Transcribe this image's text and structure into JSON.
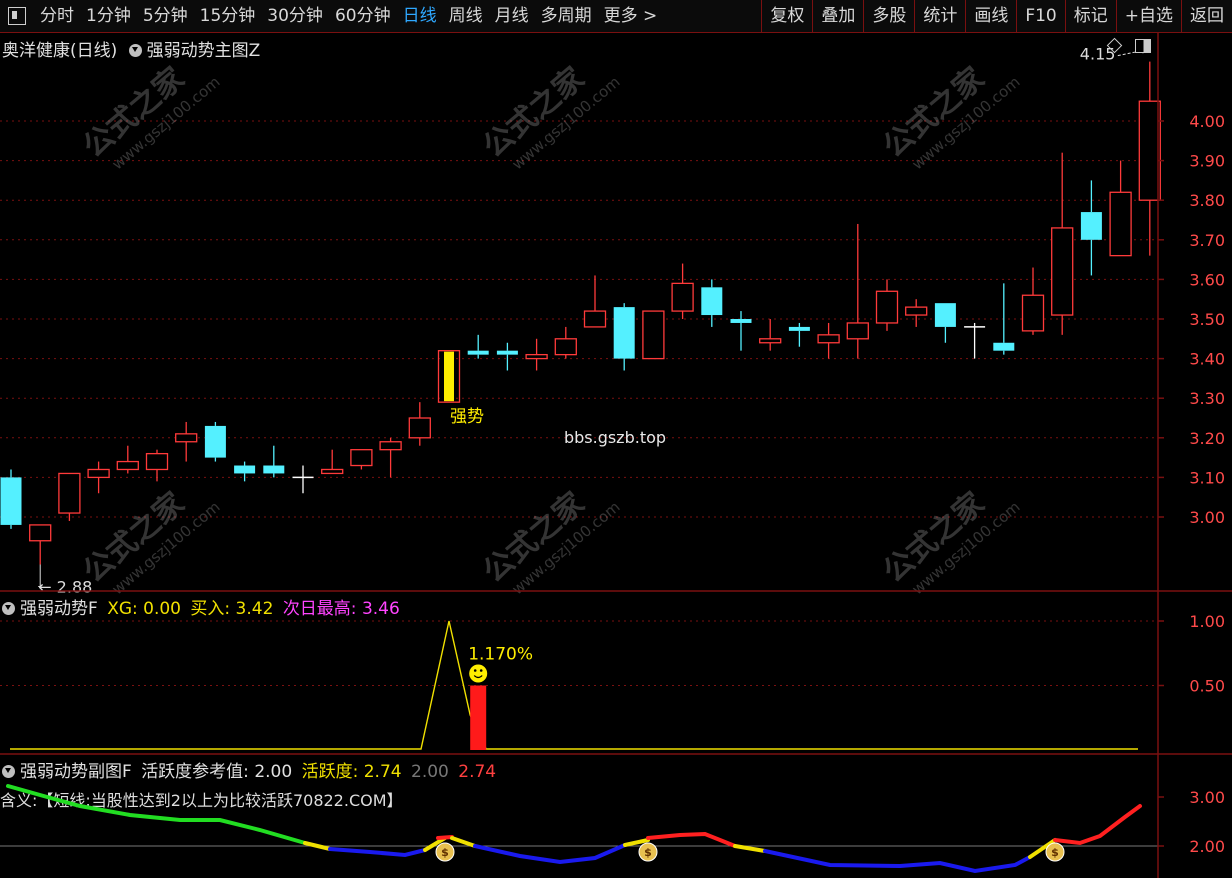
{
  "toolbar": {
    "left": [
      "分时",
      "1分钟",
      "5分钟",
      "15分钟",
      "30分钟",
      "60分钟",
      "日线",
      "周线",
      "月线",
      "多周期",
      "更多 >"
    ],
    "active": "日线",
    "right": [
      "复权",
      "叠加",
      "多股",
      "统计",
      "画线",
      "F10",
      "标记",
      "+自选",
      "返回"
    ]
  },
  "main": {
    "stock_title": "奥洋健康(日线)",
    "indicator_title": "强弱动势主图Z",
    "annotation_strong": "强势",
    "watermark_site": "bbs.gszb.top",
    "watermark_text": "公式之家",
    "watermark_url": "www.gszj100.com",
    "low_label": "2.88",
    "high_label": "4.15",
    "price_ticks": [
      "4.00",
      "3.90",
      "3.80",
      "3.70",
      "3.60",
      "3.50",
      "3.40",
      "3.30",
      "3.20",
      "3.10",
      "3.00"
    ]
  },
  "sub1": {
    "name": "强弱动势F",
    "xg_label": "XG:",
    "xg_value": "0.00",
    "buy_label": "买入:",
    "buy_value": "3.42",
    "nexthigh_label": "次日最高:",
    "nexthigh_value": "3.46",
    "pct_label": "1.170%",
    "ticks": [
      "1.00",
      "0.50"
    ]
  },
  "sub2": {
    "name": "强弱动势副图F",
    "ref_label": "活跃度参考值:",
    "ref_value": "2.00",
    "act_label": "活跃度:",
    "act_value": "2.74",
    "extra1": "2.00",
    "extra2": "2.74",
    "desc": "含义:【短线:当股性达到2以上为比较活跃70822.COM】",
    "ticks": [
      "3.00",
      "2.00"
    ]
  },
  "colors": {
    "up": "#ff3a3a",
    "down": "#54f0ff",
    "strong": "#ffee00",
    "grid": "#7a1010",
    "yellow": "#f0e000",
    "magenta": "#ff44ff"
  },
  "chart_data": [
    {
      "type": "candlestick",
      "title": "奥洋健康(日线)",
      "ylim": [
        2.85,
        4.18
      ],
      "candles": [
        [
          3.1,
          3.12,
          2.97,
          2.98
        ],
        [
          2.94,
          2.98,
          2.88,
          2.98
        ],
        [
          3.01,
          3.11,
          2.99,
          3.11
        ],
        [
          3.1,
          3.14,
          3.06,
          3.12
        ],
        [
          3.12,
          3.18,
          3.11,
          3.14
        ],
        [
          3.12,
          3.17,
          3.09,
          3.16
        ],
        [
          3.19,
          3.24,
          3.14,
          3.21
        ],
        [
          3.23,
          3.24,
          3.14,
          3.15
        ],
        [
          3.13,
          3.14,
          3.09,
          3.11
        ],
        [
          3.13,
          3.18,
          3.1,
          3.11
        ],
        [
          3.1,
          3.13,
          3.06,
          3.1
        ],
        [
          3.11,
          3.17,
          3.11,
          3.12
        ],
        [
          3.13,
          3.16,
          3.12,
          3.17
        ],
        [
          3.17,
          3.2,
          3.1,
          3.19
        ],
        [
          3.2,
          3.29,
          3.18,
          3.25
        ],
        [
          3.29,
          3.42,
          3.29,
          3.42
        ],
        [
          3.42,
          3.46,
          3.4,
          3.41
        ],
        [
          3.42,
          3.44,
          3.37,
          3.41
        ],
        [
          3.4,
          3.45,
          3.37,
          3.41
        ],
        [
          3.41,
          3.48,
          3.4,
          3.45
        ],
        [
          3.48,
          3.61,
          3.48,
          3.52
        ],
        [
          3.53,
          3.54,
          3.37,
          3.4
        ],
        [
          3.4,
          3.52,
          3.4,
          3.52
        ],
        [
          3.52,
          3.64,
          3.5,
          3.59
        ],
        [
          3.58,
          3.6,
          3.48,
          3.51
        ],
        [
          3.5,
          3.52,
          3.42,
          3.49
        ],
        [
          3.44,
          3.5,
          3.42,
          3.45
        ],
        [
          3.48,
          3.49,
          3.43,
          3.47
        ],
        [
          3.44,
          3.49,
          3.4,
          3.46
        ],
        [
          3.45,
          3.74,
          3.4,
          3.49
        ],
        [
          3.49,
          3.6,
          3.47,
          3.57
        ],
        [
          3.51,
          3.55,
          3.48,
          3.53
        ],
        [
          3.54,
          3.54,
          3.44,
          3.48
        ],
        [
          3.48,
          3.49,
          3.4,
          3.48
        ],
        [
          3.44,
          3.59,
          3.41,
          3.42
        ],
        [
          3.47,
          3.63,
          3.46,
          3.56
        ],
        [
          3.51,
          3.92,
          3.46,
          3.73
        ],
        [
          3.77,
          3.85,
          3.61,
          3.7
        ],
        [
          3.66,
          3.9,
          3.66,
          3.82
        ],
        [
          3.8,
          4.15,
          3.66,
          4.05
        ]
      ],
      "strong_index": 15
    },
    {
      "type": "line",
      "title": "强弱动势F",
      "ylim": [
        0,
        1.1
      ],
      "peak_value": 1.0,
      "bar_value": 0.5
    },
    {
      "type": "line",
      "title": "强弱动势副图F",
      "ylim": [
        1.5,
        3.6
      ],
      "reference": 2.0
    }
  ]
}
